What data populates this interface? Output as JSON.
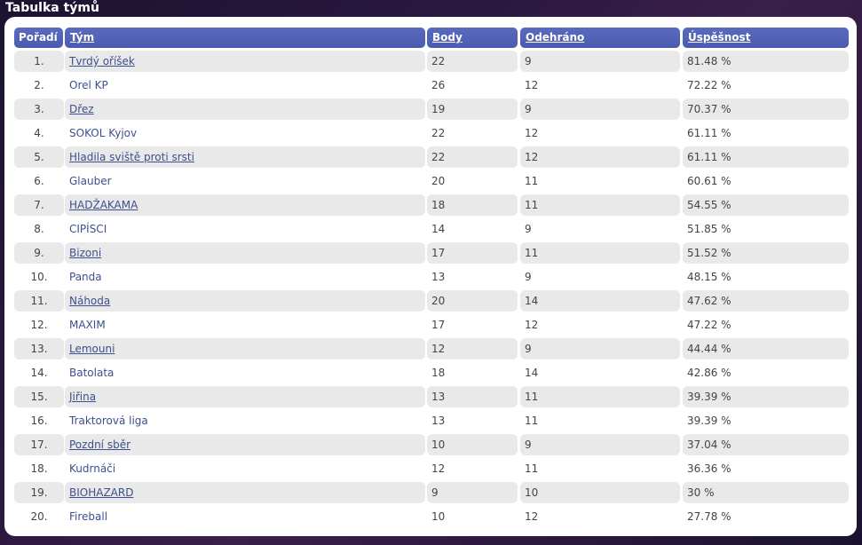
{
  "title": "Tabulka týmů",
  "colors": {
    "header_bg": "#4e5fb4",
    "row_alt_bg": "#e9e9e9",
    "link": "#3d4f8f",
    "text": "#444444"
  },
  "headers": {
    "rank": "Pořadí",
    "team": "Tým",
    "points": "Body",
    "played": "Odehráno",
    "success": "Úspěšnost"
  },
  "rows": [
    {
      "rank": "1.",
      "team": "Tvrdý oříšek",
      "points": "22",
      "played": "9",
      "success": "81.48 %"
    },
    {
      "rank": "2.",
      "team": "Orel KP",
      "points": "26",
      "played": "12",
      "success": "72.22 %"
    },
    {
      "rank": "3.",
      "team": "Dřez",
      "points": "19",
      "played": "9",
      "success": "70.37 %"
    },
    {
      "rank": "4.",
      "team": "SOKOL Kyjov",
      "points": "22",
      "played": "12",
      "success": "61.11 %"
    },
    {
      "rank": "5.",
      "team": "Hladila sviště proti srsti",
      "points": "22",
      "played": "12",
      "success": "61.11 %"
    },
    {
      "rank": "6.",
      "team": "Glauber",
      "points": "20",
      "played": "11",
      "success": "60.61 %"
    },
    {
      "rank": "7.",
      "team": "HADŽAKAMA",
      "points": "18",
      "played": "11",
      "success": "54.55 %"
    },
    {
      "rank": "8.",
      "team": "CIPÍSCI",
      "points": "14",
      "played": "9",
      "success": "51.85 %"
    },
    {
      "rank": "9.",
      "team": "Bizoni",
      "points": "17",
      "played": "11",
      "success": "51.52 %"
    },
    {
      "rank": "10.",
      "team": "Panda",
      "points": "13",
      "played": "9",
      "success": "48.15 %"
    },
    {
      "rank": "11.",
      "team": "Náhoda",
      "points": "20",
      "played": "14",
      "success": "47.62 %"
    },
    {
      "rank": "12.",
      "team": "MAXIM",
      "points": "17",
      "played": "12",
      "success": "47.22 %"
    },
    {
      "rank": "13.",
      "team": "Lemouni",
      "points": "12",
      "played": "9",
      "success": "44.44 %"
    },
    {
      "rank": "14.",
      "team": "Batolata",
      "points": "18",
      "played": "14",
      "success": "42.86 %"
    },
    {
      "rank": "15.",
      "team": "Jiřina",
      "points": "13",
      "played": "11",
      "success": "39.39 %"
    },
    {
      "rank": "16.",
      "team": "Traktorová liga",
      "points": "13",
      "played": "11",
      "success": "39.39 %"
    },
    {
      "rank": "17.",
      "team": "Pozdní sběr",
      "points": "10",
      "played": "9",
      "success": "37.04 %"
    },
    {
      "rank": "18.",
      "team": "Kudrnáči",
      "points": "12",
      "played": "11",
      "success": "36.36 %"
    },
    {
      "rank": "19.",
      "team": "BIOHAZARD",
      "points": "9",
      "played": "10",
      "success": "30 %"
    },
    {
      "rank": "20.",
      "team": "Fireball",
      "points": "10",
      "played": "12",
      "success": "27.78 %"
    }
  ]
}
